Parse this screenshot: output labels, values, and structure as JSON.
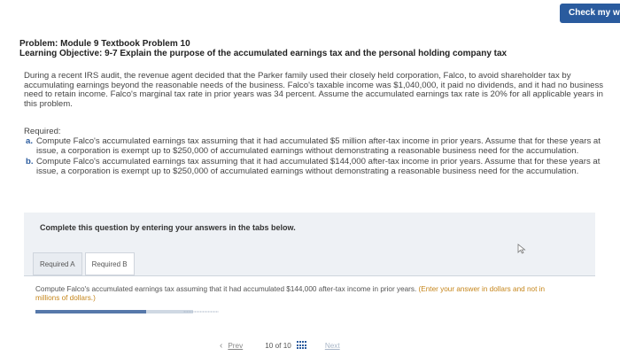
{
  "header": {
    "check_button": "Check my w"
  },
  "problem": {
    "title": "Problem: Module 9 Textbook Problem 10",
    "objective_label": "Learning Objective: 9-7",
    "objective_text": " Explain the purpose of the accumulated earnings tax and the personal holding company tax"
  },
  "intro": "During a recent IRS audit, the revenue agent decided that the Parker family used their closely held corporation, Falco, to avoid shareholder tax by accumulating earnings beyond the reasonable needs of the business. Falco's taxable income was $1,040,000, it paid no dividends, and it had no business need to retain income. Falco's marginal tax rate in prior years was 34 percent. Assume the accumulated earnings tax rate is 20% for all applicable years in this problem.",
  "required": {
    "heading": "Required:",
    "items": [
      {
        "letter": "a.",
        "text": "Compute Falco's accumulated earnings tax assuming that it had accumulated $5 million after-tax income in prior years. Assume that for these years at issue, a corporation is exempt up to $250,000 of accumulated earnings without demonstrating a reasonable business need for the accumulation."
      },
      {
        "letter": "b.",
        "text": "Compute Falco's accumulated earnings tax assuming that it had accumulated $144,000 after-tax income in prior years. Assume that for these years at issue, a corporation is exempt up to $250,000 of accumulated earnings without demonstrating a reasonable business need for the accumulation."
      }
    ]
  },
  "panel": {
    "instruction": "Complete this question by entering your answers in the tabs below.",
    "tabs": [
      {
        "label": "Required A"
      },
      {
        "label": "Required B"
      }
    ],
    "tab_instruction": "Compute Falco's accumulated earnings tax assuming that it had accumulated $144,000 after-tax income in prior years.",
    "tab_hint": " (Enter your answer in dollars and not in millions of dollars.)",
    "progress": 0.7
  },
  "nav": {
    "prev_label": "Prev",
    "page_current": "10",
    "page_sep": "of",
    "page_total": "10",
    "next_label": "Next"
  },
  "colors": {
    "accent": "#2a5b9e",
    "hint": "#c5851a",
    "panel_bg": "#eef1f5"
  }
}
